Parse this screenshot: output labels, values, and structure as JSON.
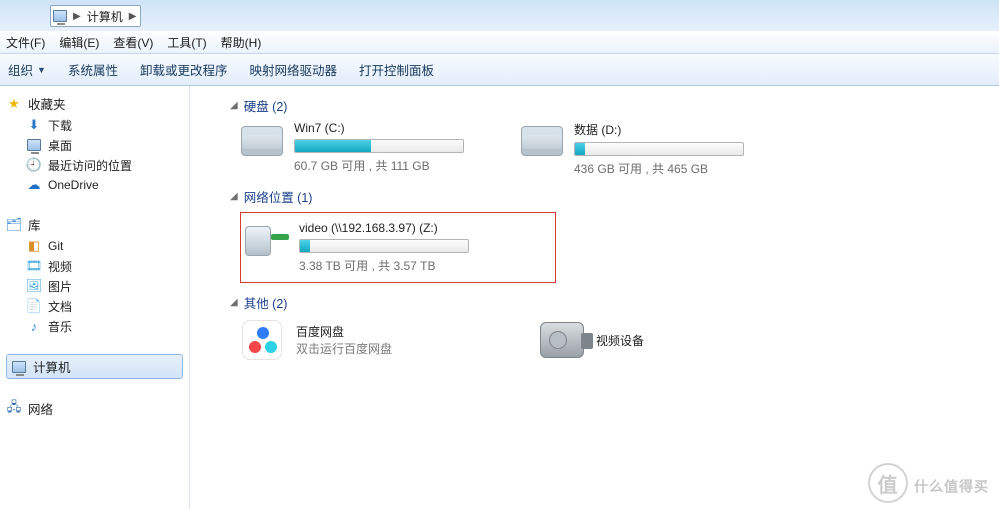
{
  "address": {
    "location": "计算机"
  },
  "menubar": {
    "file": "文件(F)",
    "edit": "编辑(E)",
    "view": "查看(V)",
    "tools": "工具(T)",
    "help": "帮助(H)"
  },
  "cmdbar": {
    "organize": "组织",
    "sysprops": "系统属性",
    "uninstall": "卸载或更改程序",
    "mapdrive": "映射网络驱动器",
    "controlpanel": "打开控制面板"
  },
  "nav": {
    "favorites": {
      "title": "收藏夹",
      "download": "下载",
      "desktop": "桌面",
      "recent": "最近访问的位置",
      "onedrive": "OneDrive"
    },
    "libraries": {
      "title": "库",
      "git": "Git",
      "video": "视频",
      "pictures": "图片",
      "documents": "文档",
      "music": "音乐"
    },
    "computer": "计算机",
    "network": "网络"
  },
  "sections": {
    "drives": "硬盘 (2)",
    "netloc": "网络位置 (1)",
    "other": "其他 (2)"
  },
  "drives": {
    "c": {
      "name": "Win7 (C:)",
      "sub": "60.7 GB 可用 , 共 111 GB"
    },
    "d": {
      "name": "数据 (D:)",
      "sub": "436 GB 可用 , 共 465 GB"
    }
  },
  "netdrive": {
    "z": {
      "name": "video (\\\\192.168.3.97) (Z:)",
      "sub": "3.38 TB 可用 , 共 3.57 TB"
    }
  },
  "other": {
    "baidu": {
      "title": "百度网盘",
      "sub": "双击运行百度网盘"
    },
    "camera": {
      "title": "视频设备"
    }
  },
  "watermark": "什么值得买"
}
